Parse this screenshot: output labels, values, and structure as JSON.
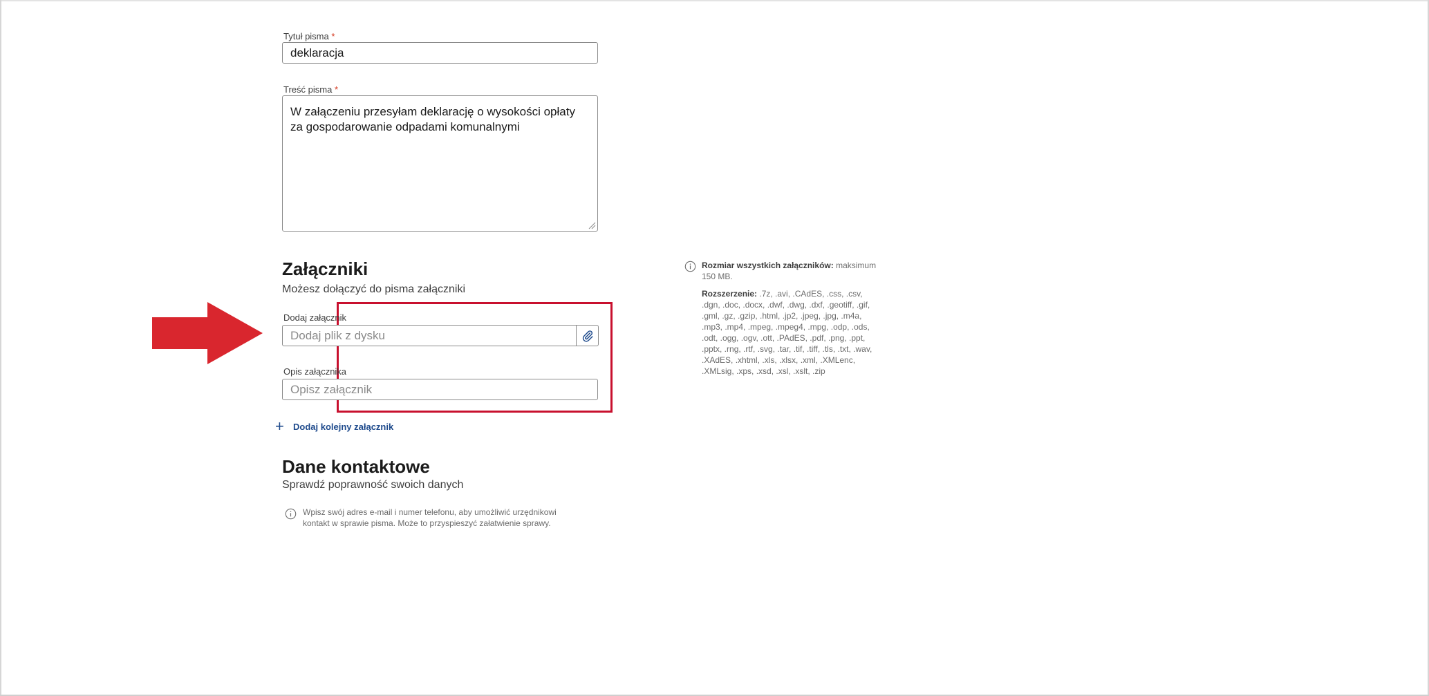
{
  "form": {
    "title_label": "Tytuł pisma",
    "title_value": "deklaracja",
    "body_label": "Treść pisma",
    "body_value": "W załączeniu przesyłam deklarację o wysokości opłaty za gospodarowanie odpadami komunalnymi",
    "required_mark": "*"
  },
  "attachments": {
    "heading": "Załączniki",
    "subtitle": "Możesz dołączyć do pisma załączniki",
    "add_label": "Dodaj załącznik",
    "add_placeholder": "Dodaj plik z dysku",
    "desc_label": "Opis załącznika",
    "desc_placeholder": "Opisz załącznik",
    "add_more": "Dodaj kolejny załącznik",
    "size_label": "Rozmiar wszystkich załączników:",
    "size_value": "maksimum 150 MB.",
    "ext_label": "Rozszerzenie:",
    "ext_value": ".7z, .avi, .CAdES, .css, .csv, .dgn, .doc, .docx, .dwf, .dwg, .dxf, .geotiff, .gif, .gml, .gz, .gzip, .html, .jp2, .jpeg, .jpg, .m4a, .mp3, .mp4, .mpeg, .mpeg4, .mpg, .odp, .ods, .odt, .ogg, .ogv, .ott, .PAdES, .pdf, .png, .ppt, .pptx, .rng, .rtf, .svg, .tar, .tif, .tiff, .tls, .txt, .wav, .XAdES, .xhtml, .xls, .xlsx, .xml, .XMLenc, .XMLsig, .xps, .xsd, .xsl, .xslt, .zip"
  },
  "contact": {
    "heading": "Dane kontaktowe",
    "subtitle": "Sprawdź poprawność swoich danych",
    "note": "Wpisz swój adres e-mail i numer telefonu, aby umożliwić urzędnikowi kontakt w sprawie pisma. Może to przyspieszyć załatwienie sprawy."
  },
  "colors": {
    "accent": "#1e4a8c",
    "highlight": "#c8102e",
    "arrow": "#d9262e"
  },
  "icons": {
    "attach": "paperclip-icon",
    "info": "info-circle-icon",
    "add": "plus-icon",
    "pointer": "arrow-right-icon"
  }
}
